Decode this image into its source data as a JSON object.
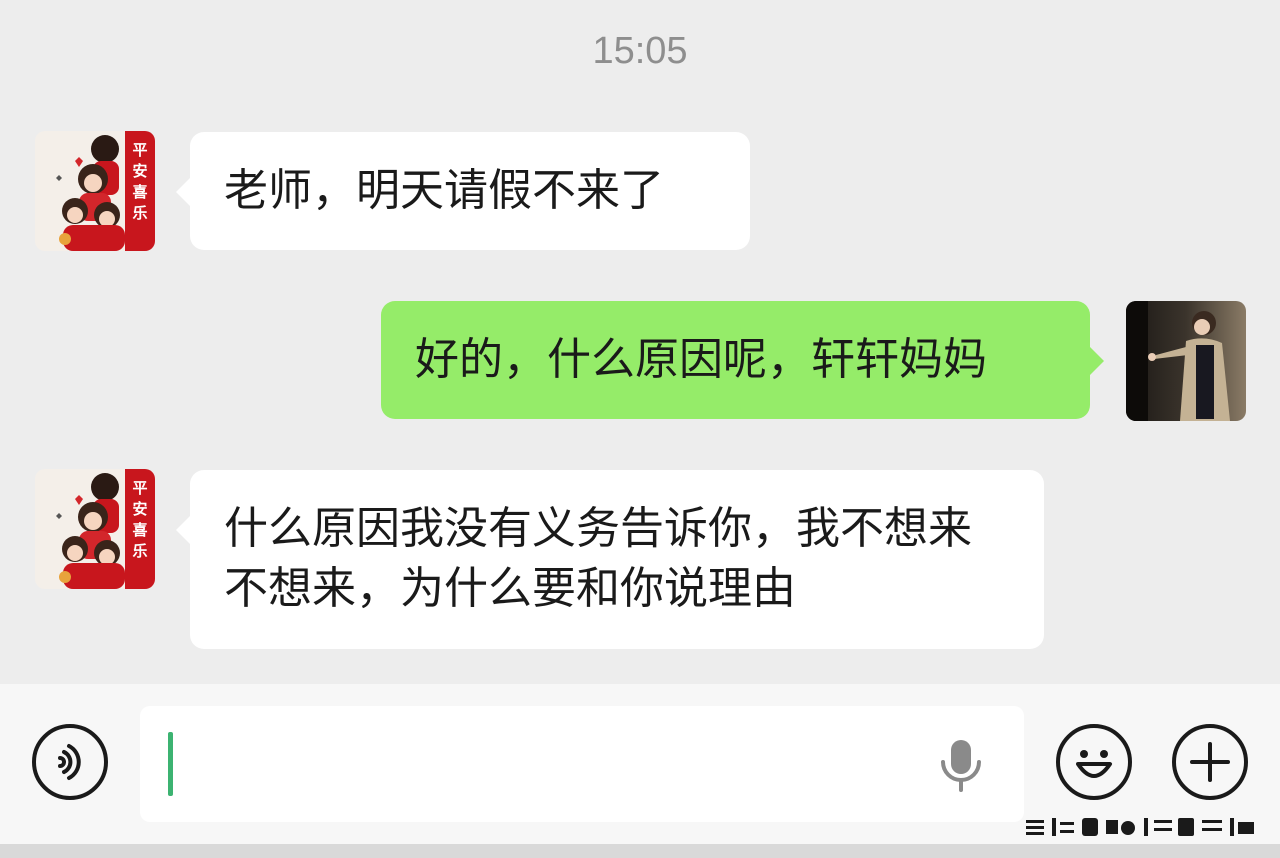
{
  "chat": {
    "timestamp": "15:05",
    "messages": [
      {
        "side": "left",
        "text": "老师，明天请假不来了"
      },
      {
        "side": "right",
        "text": "好的，什么原因呢，轩轩妈妈"
      },
      {
        "side": "left",
        "text": "什么原因我没有义务告诉你，我不想来不想来，为什么要和你说理由"
      }
    ],
    "avatar_stamp_text": "平安喜乐"
  },
  "input_bar": {
    "voice_icon": "voice-mode-icon",
    "microphone_icon": "microphone-icon",
    "emoji_icon": "emoji-smile-icon",
    "more_icon": "plus-icon",
    "input_value": ""
  },
  "colors": {
    "background": "#ededed",
    "incoming_bubble": "#ffffff",
    "outgoing_bubble": "#95ec69",
    "cursor": "#3cb371",
    "stamp_red": "#c8161d"
  }
}
